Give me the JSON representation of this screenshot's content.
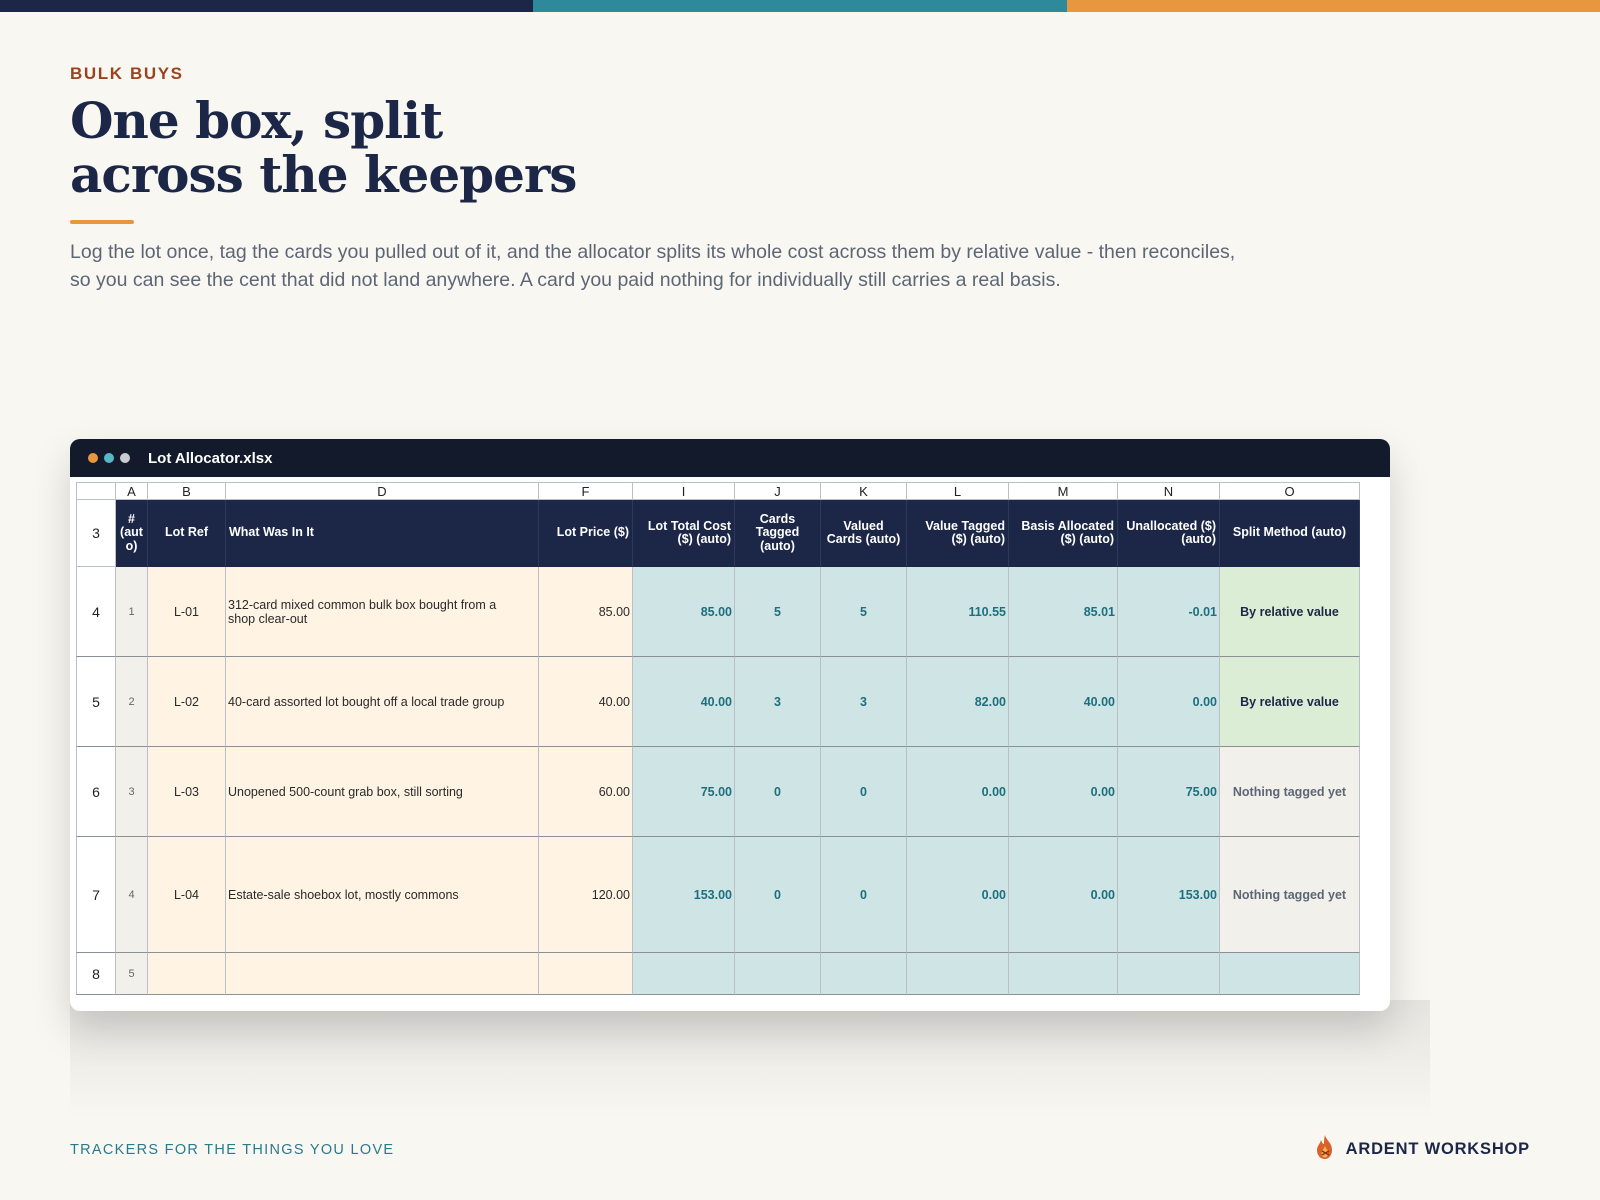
{
  "colors": {
    "navy": "#1c2747",
    "teal": "#2e8a9a",
    "orange": "#e9973f",
    "rust": "#9a4320",
    "auto_fill": "#cfe5e5",
    "input_fill": "#fff3e4",
    "ok_fill": "#dcedd5"
  },
  "header": {
    "eyebrow": "BULK BUYS",
    "title_line1": "One box, split",
    "title_line2": "across the keepers",
    "lead": "Log the lot once, tag the cards you pulled out of it, and the allocator splits its whole cost across them by relative value - then reconciles, so you can see the cent that did not land anywhere. A card you paid nothing for individually still carries a real basis."
  },
  "window": {
    "title": "Lot Allocator.xlsx",
    "dots": [
      "#e9973f",
      "#58b7c7",
      "#c9ccd3"
    ]
  },
  "sheet": {
    "column_letters": [
      "A",
      "B",
      "D",
      "F",
      "I",
      "J",
      "K",
      "L",
      "M",
      "N",
      "O"
    ],
    "header_row_number": "3",
    "headers": [
      "# (aut o)",
      "Lot Ref",
      "What Was In It",
      "Lot Price ($)",
      "Lot Total Cost ($) (auto)",
      "Cards Tagged (auto)",
      "Valued Cards (auto)",
      "Value Tagged ($) (auto)",
      "Basis Allocated ($) (auto)",
      "Unallocated ($) (auto)",
      "Split Method (auto)"
    ],
    "rows": [
      {
        "rownum": "4",
        "idx": "1",
        "ref": "L-01",
        "desc": "312-card mixed common bulk box bought from a shop clear-out",
        "price": "85.00",
        "total": "85.00",
        "tagged": "5",
        "valued": "5",
        "value": "110.55",
        "basis": "85.01",
        "unalloc": "-0.01",
        "method": "By relative value",
        "status": "ok"
      },
      {
        "rownum": "5",
        "idx": "2",
        "ref": "L-02",
        "desc": "40-card assorted lot bought off a local trade group",
        "price": "40.00",
        "total": "40.00",
        "tagged": "3",
        "valued": "3",
        "value": "82.00",
        "basis": "40.00",
        "unalloc": "0.00",
        "method": "By relative value",
        "status": "ok"
      },
      {
        "rownum": "6",
        "idx": "3",
        "ref": "L-03",
        "desc": "Unopened 500-count grab box, still sorting",
        "price": "60.00",
        "total": "75.00",
        "tagged": "0",
        "valued": "0",
        "value": "0.00",
        "basis": "0.00",
        "unalloc": "75.00",
        "method": "Nothing tagged yet",
        "status": "none"
      },
      {
        "rownum": "7",
        "idx": "4",
        "ref": "L-04",
        "desc": "Estate-sale shoebox lot, mostly commons",
        "price": "120.00",
        "total": "153.00",
        "tagged": "0",
        "valued": "0",
        "value": "0.00",
        "basis": "0.00",
        "unalloc": "153.00",
        "method": "Nothing tagged yet",
        "status": "none"
      },
      {
        "rownum": "8",
        "idx": "5",
        "ref": "",
        "desc": "",
        "price": "",
        "total": "",
        "tagged": "",
        "valued": "",
        "value": "",
        "basis": "",
        "unalloc": "",
        "method": "",
        "status": "empty"
      }
    ]
  },
  "footer": {
    "tagline": "TRACKERS FOR THE THINGS YOU LOVE",
    "brand": "ARDENT WORKSHOP",
    "brand_icon": "flame-icon"
  }
}
